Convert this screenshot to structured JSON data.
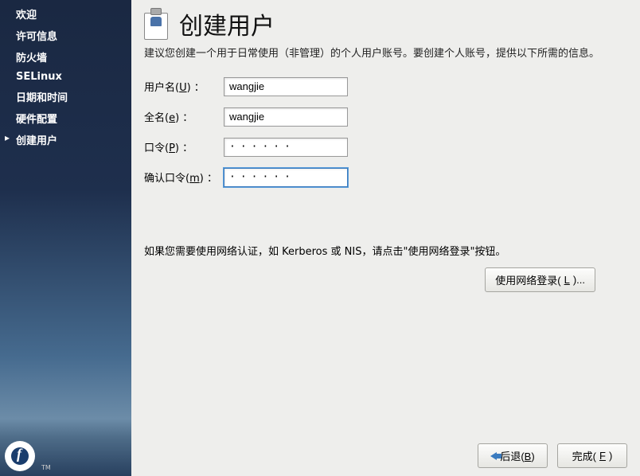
{
  "sidebar": {
    "items": [
      {
        "label": "欢迎",
        "active": false
      },
      {
        "label": "许可信息",
        "active": false
      },
      {
        "label": "防火墙",
        "active": false
      },
      {
        "label": "SELinux",
        "active": false
      },
      {
        "label": "日期和时间",
        "active": false
      },
      {
        "label": "硬件配置",
        "active": false
      },
      {
        "label": "创建用户",
        "active": true
      }
    ]
  },
  "main": {
    "title": "创建用户",
    "description": "建议您创建一个用于日常使用（非管理）的个人用户账号。要创建个人账号，提供以下所需的信息。",
    "labels": {
      "username_pre": "用户名(",
      "username_key": "U",
      "username_post": ") ：",
      "fullname_pre": "全名(",
      "fullname_key": "e",
      "fullname_post": ") ：",
      "password_pre": "口令(",
      "password_key": "P",
      "password_post": ") ：",
      "confirm_pre": "确认口令(",
      "confirm_key": "m",
      "confirm_post": ") ："
    },
    "values": {
      "username": "wangjie",
      "fullname": "wangjie",
      "password": "······",
      "confirm": "······"
    },
    "network_hint": "如果您需要使用网络认证，如 Kerberos 或 NIS，请点击\"使用网络登录\"按钮。",
    "network_button_pre": "使用网络登录(",
    "network_button_key": "L",
    "network_button_post": ")...",
    "back_pre": "后退(",
    "back_key": "B",
    "back_post": ")",
    "finish_pre": "完成(",
    "finish_key": "F",
    "finish_post": ")"
  }
}
